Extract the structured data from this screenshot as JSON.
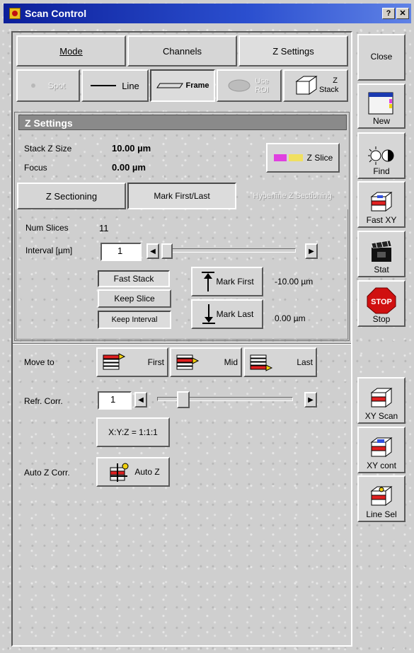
{
  "window": {
    "title": "Scan Control",
    "help_label": "?",
    "close_label": "✕"
  },
  "tabs": [
    "Mode",
    "Channels",
    "Z Settings"
  ],
  "modes": {
    "spot": "Spot",
    "line": "Line",
    "frame": "Frame",
    "roi": "Use ROI",
    "zstack": "Z Stack"
  },
  "z_settings": {
    "title": "Z Settings",
    "stack_size_label": "Stack Z Size",
    "stack_size_value": "10.00 µm",
    "focus_label": "Focus",
    "focus_value": "0.00 µm",
    "zslice_label": "Z Slice",
    "subtabs": [
      "Z Sectioning",
      "Mark First/Last",
      "Hyperfine Z Sectioning"
    ],
    "num_slices_label": "Num Slices",
    "num_slices_value": "11",
    "interval_label": "Interval [µm]",
    "interval_value": "1",
    "fast_stack": "Fast Stack",
    "keep_slice": "Keep Slice",
    "keep_interval": "Keep Interval",
    "mark_first": "Mark First",
    "mark_first_value": "-10.00 µm",
    "mark_last": "Mark Last",
    "mark_last_value": "0.00 µm"
  },
  "move": {
    "label": "Move to",
    "first": "First",
    "mid": "Mid",
    "last": "Last"
  },
  "refr": {
    "label": "Refr. Corr.",
    "value": "1",
    "ratio_label": "X:Y:Z = 1:1:1"
  },
  "autoz": {
    "label": "Auto Z Corr.",
    "button": "Auto Z"
  },
  "side": {
    "close": "Close",
    "new": "New",
    "find": "Find",
    "fastxy": "Fast XY",
    "stat": "Stat",
    "stop": "Stop",
    "stop_sign": "STOP",
    "xyscan": "XY Scan",
    "xycont": "XY cont",
    "linesel": "Line Sel"
  },
  "colors": {
    "title_bar": "#0c1f9a",
    "stop_red": "#d01010",
    "stack_red": "#e02020",
    "stack_yellow": "#f0d010"
  }
}
